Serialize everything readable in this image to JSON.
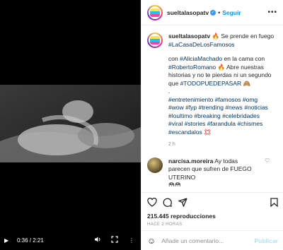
{
  "video": {
    "time": "0:36 / 2:21",
    "icons": [
      "play-icon",
      "volume-icon",
      "fullscreen-icon",
      "more-vertical-icon"
    ]
  },
  "post": {
    "username": "sueltalasopatv",
    "dot": "•",
    "follow_label": "Seguir",
    "more": "•••",
    "caption_line1_user": "sueltalasopatv",
    "caption_line1": "🔥 Se prende en fuego",
    "caption_tag1": "#LaCasaDeLosFamosos",
    "caption_p2a": "con",
    "caption_tag_alicia": "#AliciaMachado",
    "caption_p2b": "en la cama con",
    "caption_tag_roberto": "#RobertoRomano",
    "caption_p2c": "🔥 Abre nuestras historias y no te pierdas ni un segundo que",
    "caption_tag_todo": "#TODOPUEDEPASAR",
    "caption_p2d": "🙈",
    "caption_p3_dot": ".",
    "hashtags": "#entretenimiento #famosos #omg #wow #fyp #trending #news #noticias #loultimo #breaking #celebridades #viral #stories #farandula #chismes #escandalos",
    "hashtags_end": "💢",
    "ago": "2 h"
  },
  "comment": {
    "user": "narcisa.moreira",
    "text": "Ay todas parecen que sufren de FUEGO UTERINO",
    "emoji": "😳😳"
  },
  "stats": {
    "views": "215.445 reproducciones",
    "date": "HACE 2 HORAS"
  },
  "add_comment": {
    "placeholder": "Añade un comentario...",
    "publish": "Publicar"
  }
}
